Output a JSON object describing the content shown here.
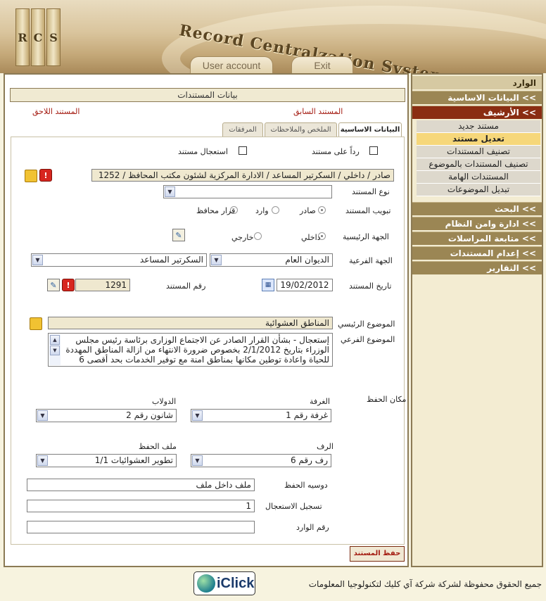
{
  "header": {
    "logo_letters": [
      "R",
      "C",
      "S"
    ],
    "system_title": "Record Centralzation System",
    "user_account_label": "User account",
    "exit_label": "Exit"
  },
  "sidebar": {
    "items": [
      {
        "label": "الوارد",
        "type": "top"
      },
      {
        "label": ">> البيانات الاساسية",
        "type": "cat"
      },
      {
        "label": ">> الأرشيف",
        "type": "active"
      },
      {
        "label": "مستند جديد",
        "type": "sub"
      },
      {
        "label": "تعديل مستند",
        "type": "sub-selected"
      },
      {
        "label": "تصنيف المستندات",
        "type": "sub"
      },
      {
        "label": "تصنيف المستندات بالموضوع",
        "type": "sub"
      },
      {
        "label": "المستندات الهامة",
        "type": "sub"
      },
      {
        "label": "تبديل الموضوعات",
        "type": "sub"
      },
      {
        "label": ">> البحث",
        "type": "cat"
      },
      {
        "label": ">> ادارة وامن النظام",
        "type": "cat"
      },
      {
        "label": ">> متابعة المراسلات",
        "type": "cat"
      },
      {
        "label": ">> إعدام المستندات",
        "type": "cat"
      },
      {
        "label": ">> التقارير",
        "type": "cat"
      }
    ]
  },
  "main": {
    "title": "بيانات المستندات",
    "prev_doc": "المستند السابق",
    "next_doc": "المستند اللاحق",
    "tabs": [
      "البيانات الاساسية",
      "الملخص والملاحظات",
      "المرفقات"
    ],
    "reply_label": "رداً على مستند",
    "urgent_label": "استعجال مستند",
    "path_value": "صادر / داخلي / السكرتير المساعد  / الادارة المركزية لشئون مكتب المحافظ / 1252",
    "doc_type_label": "نوع المستند",
    "doc_type_value": "",
    "classification_label": "تبويب المستند",
    "class_options": [
      "صادر",
      "وارد",
      "قرار محافظ"
    ],
    "main_entity_label": "الجهة الرئيسية",
    "entity_options": [
      "داخلي",
      "خارجي"
    ],
    "sub_entity_label": "الجهة الفرعية",
    "sub_entity_1": "الديوان العام",
    "sub_entity_2": "السكرتير المساعد",
    "doc_date_label": "تاريخ المستند",
    "doc_date_value": "19/02/2012",
    "doc_number_label": "رقم المستند",
    "doc_number_value": "1291",
    "main_subject_label": "الموضوع الرئيسي",
    "main_subject_value": "المناطق العشوائية",
    "sub_subject_label": "الموضوع الفرعي",
    "sub_subject_lines": [
      "إستعجال - بشأن القرار الصادر عن الاجتماع الوزارى برئاسة رئيس مجلس",
      "الوزراء بتاريخ 2/1/2012 بخصوص ضرورة الانتهاء من ازالة المناطق المهددة",
      "للحياة واعادة توطين مكانها بمناطق امنة مع توفير الخدمات بحد أقصى 6"
    ],
    "storage_place_label": "مكان الحفظ",
    "room_label": "الغرفة",
    "room_value": "غرفة رقم 1",
    "cabinet_label": "الدولاب",
    "cabinet_value": "شانون رقم 2",
    "shelf_label": "الرف",
    "shelf_value": "رف رقم 6",
    "file_label": "ملف الحفظ",
    "file_value": "تطوير العشوائيات 1/1",
    "folder_desc_label": "دوسيه الحفظ",
    "folder_desc_value": "ملف داخل ملف",
    "urgency_reg_label": "تسجيل الاستعجال",
    "urgency_reg_value": "1",
    "incoming_num_label": "رقم الوارد",
    "incoming_num_value": "",
    "save_label": "حفظ المستند"
  },
  "footer": {
    "logo_text": "iClick",
    "copyright": "جميع الحقوق محفوظة لشركة شركة آي كليك لتكنولوجيا المعلومات"
  }
}
